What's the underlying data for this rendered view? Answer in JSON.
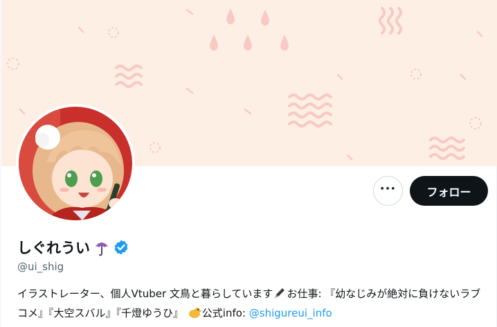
{
  "profile": {
    "display_name": "しぐれうい",
    "handle": "@ui_shig",
    "verified": true,
    "bio_part1": "イラストレーター、個人Vtuber 文鳥と暮らしています",
    "bio_part2": "お仕事: 『幼なじみが絶対に負けないラブコメ』『大空スバル』『千燈ゆうひ』",
    "bio_part3": "公式info: ",
    "bio_link": "@shigureui_info"
  },
  "actions": {
    "more_label": "···",
    "follow_label": "フォロー"
  },
  "icons": {
    "name_emoji": "umbrella-icon",
    "verified_badge": "verified-badge-icon",
    "bio_emoji_1": "pen-icon",
    "bio_emoji_2": "bird-icon"
  },
  "colors": {
    "banner_bg": "#fdefe4",
    "banner_pattern": "#f9c9c4",
    "accent_link": "#1d9bf0",
    "follow_button": "#0f1419"
  }
}
